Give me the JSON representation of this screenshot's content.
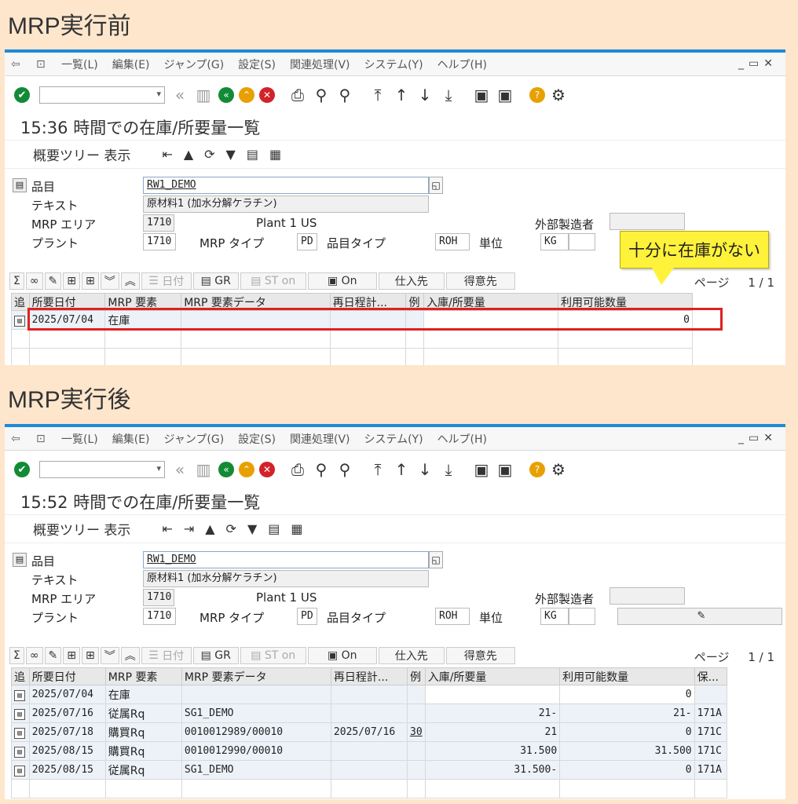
{
  "before": {
    "heading": "MRP実行前",
    "time_title": "15:36 時間での在庫/所要量一覧",
    "rows": [
      {
        "date": "2025/07/04",
        "element": "在庫",
        "data": "",
        "resched": "",
        "ex": "",
        "receipt": "",
        "avail": "0",
        "storage": ""
      }
    ],
    "callout": "十分に在庫がない"
  },
  "after": {
    "heading": "MRP実行後",
    "time_title": "15:52 時間での在庫/所要量一覧",
    "rows": [
      {
        "date": "2025/07/04",
        "element": "在庫",
        "data": "",
        "resched": "",
        "ex": "",
        "receipt": "",
        "avail": "0",
        "storage": ""
      },
      {
        "date": "2025/07/16",
        "element": "従属Rq",
        "data": "SG1_DEMO",
        "resched": "",
        "ex": "",
        "receipt": "21-",
        "avail": "21-",
        "storage": "171A"
      },
      {
        "date": "2025/07/18",
        "element": "購買Rq",
        "data": "0010012989/00010",
        "resched": "2025/07/16",
        "ex": "30",
        "receipt": "21",
        "avail": "0",
        "storage": "171C"
      },
      {
        "date": "2025/08/15",
        "element": "購買Rq",
        "data": "0010012990/00010",
        "resched": "",
        "ex": "",
        "receipt": "31.500",
        "avail": "31.500",
        "storage": "171C"
      },
      {
        "date": "2025/08/15",
        "element": "従属Rq",
        "data": "SG1_DEMO",
        "resched": "",
        "ex": "",
        "receipt": "31.500-",
        "avail": "0",
        "storage": "171A"
      }
    ]
  },
  "menu": [
    "一覧(L)",
    "編集(E)",
    "ジャンプ(G)",
    "設定(S)",
    "関連処理(V)",
    "システム(Y)",
    "ヘルプ(H)"
  ],
  "app_toolbar_label": "概要ツリー 表示",
  "fields": {
    "material_label": "品目",
    "material_value": "RW1_DEMO",
    "text_label": "テキスト",
    "text_value": "原材料1 (加水分解ケラチン)",
    "mrp_area_label": "MRP エリア",
    "mrp_area_value": "1710",
    "mrp_area_desc": "Plant 1 US",
    "ext_proc_label": "外部製造者",
    "plant_label": "プラント",
    "plant_value": "1710",
    "mrp_type_label": "MRP タイプ",
    "mrp_type_value": "PD",
    "mat_type_label": "品目タイプ",
    "mat_type_value": "ROH",
    "unit_label": "単位",
    "unit_value": "KG"
  },
  "alv": {
    "btn_date": "日付",
    "btn_gr": "GR",
    "btn_st": "ST on",
    "btn_on": "On",
    "btn_vendor": "仕入先",
    "btn_customer": "得意先",
    "page_label": "ページ",
    "page_value": "1 / 1"
  },
  "columns": {
    "c0": "追",
    "c1": "所要日付",
    "c2": "MRP 要素",
    "c3": "MRP 要素データ",
    "c4": "再日程計...",
    "c5": "例",
    "c6": "入庫/所要量",
    "c7": "利用可能数量",
    "c8": "保..."
  },
  "colors": {
    "accent": "#1f8ad8",
    "background": "#fde6cc",
    "highlight": "#e02020",
    "callout": "#fff23a"
  }
}
